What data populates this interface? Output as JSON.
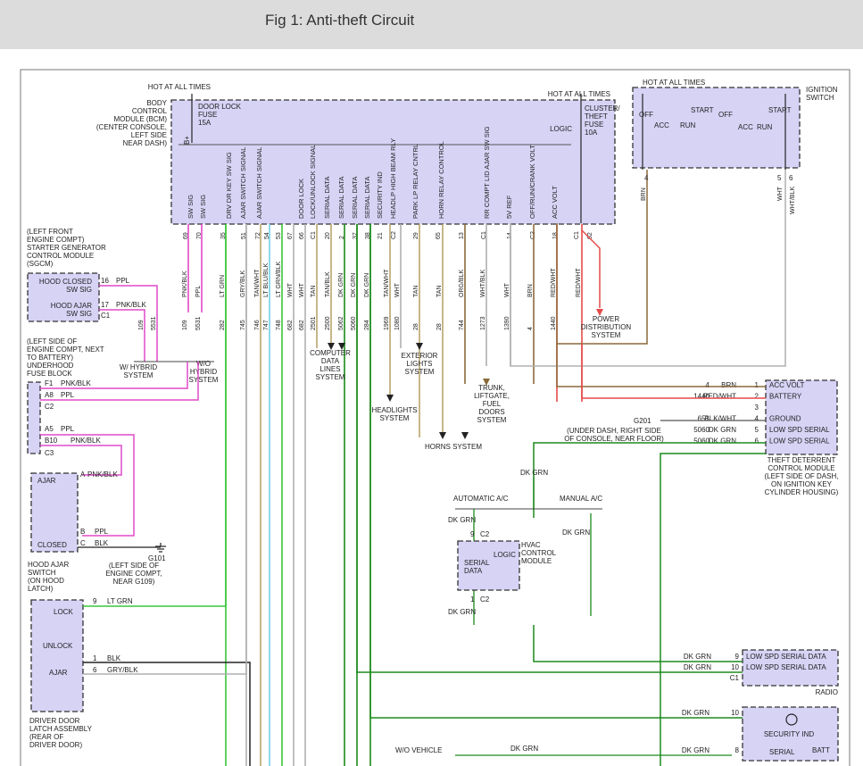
{
  "page_title": "Fig 1: Anti-theft Circuit",
  "colors": {
    "module_fill": "#d6d3f5",
    "green": "#38c638",
    "dark_green": "#1b8a1b",
    "pink": "#e04ac8",
    "brown": "#8a6a3a",
    "red": "#e64a4a",
    "gray": "#b0b0b0",
    "tan": "#b9a46d",
    "light_blue": "#6fd0e6"
  },
  "bcm": {
    "hot_at_all_times": "HOT AT ALL TIMES",
    "label_lines": [
      "BODY",
      "CONTROL",
      "MODULE (BCM)",
      "(CENTER CONSOLE,",
      "LEFT SIDE",
      "NEAR DASH)"
    ],
    "door_lock_fuse": [
      "DOOR LOCK",
      "FUSE",
      "15A"
    ],
    "b_plus": "B+",
    "hot_at_all_times_2": "HOT AT ALL TIMES",
    "cluster_fuse": [
      "CLUSTER/",
      "THEFT",
      "FUSE",
      "10A"
    ],
    "logic": "LOGIC",
    "signals": [
      "SW SIG",
      "SW SIG",
      "DRV DR KEY SW SIG",
      "AJAR SWITCH SIGNAL",
      "AJAR SWITCH SIGNAL",
      "DOOR LOCK",
      "LOCK/UNLOCK SIGNAL",
      "SERIAL DATA",
      "SERIAL DATA",
      "SERIAL DATA",
      "SERIAL DATA",
      "SECURITY IND",
      "HEADLP HIGH BEAM RLY",
      "PARK LP RELAY CNTRL",
      "HORN RELAY CONTROL",
      "RR COMPT LID AJAR SW SIG",
      "5V REF",
      "OFF/RUN/CRANK VOLT",
      "ACC VOLT"
    ],
    "pins": [
      "69",
      "70",
      "35",
      "51",
      "72",
      "54",
      "53",
      "67",
      "66",
      "C1",
      "20",
      "2",
      "37",
      "38",
      "21",
      "C2",
      "29",
      "65",
      "13",
      "C1",
      "14",
      "C2",
      "18",
      "C1",
      "62",
      "56",
      "C2",
      "C8",
      "F1",
      "C4"
    ],
    "wire_colors": [
      "PNK/BLK",
      "PPL",
      "LT GRN",
      "GRY/BLK",
      "TAN/WHT",
      "LT BLU/BLK",
      "LT GRN/BLK",
      "WHT",
      "WHT",
      "TAN",
      "TAN/BLK",
      "DK GRN",
      "DK GRN",
      "DK GRN",
      "TAN/WHT",
      "WHT",
      "TAN",
      "TAN",
      "ORG/BLK",
      "WHT/BLK",
      "WHT",
      "BRN",
      "RED/WHT",
      "RED/WHT"
    ],
    "circuits": [
      "109",
      "5531",
      "282",
      "745",
      "746",
      "747",
      "748",
      "682",
      "682",
      "2501",
      "2500",
      "5062",
      "5060",
      "284",
      "1969",
      "1080",
      "28",
      "28",
      "744",
      "1273",
      "1390",
      "4",
      "1440"
    ]
  },
  "ignition": {
    "hot": "HOT AT ALL TIMES",
    "label": [
      "IGNITION",
      "SWITCH"
    ],
    "off": "OFF",
    "start": "START",
    "acc": "ACC",
    "run": "RUN",
    "pins": [
      "4",
      "5",
      "6"
    ],
    "wire_colors": [
      "BRN",
      "WHT",
      "WHT/BLK"
    ]
  },
  "sgcm": {
    "label_lines": [
      "(LEFT FRONT",
      "ENGINE COMPT)",
      "STARTER GENERATOR",
      "CONTROL MODULE",
      "(SGCM)"
    ],
    "hood_closed": [
      "HOOD CLOSED",
      "SW SIG"
    ],
    "hood_ajar": [
      "HOOD AJAR",
      "SW SIG"
    ],
    "pins": [
      "16",
      "17",
      "C1"
    ],
    "wires": [
      "PPL",
      "PNK/BLK"
    ],
    "circuits": [
      "109",
      "5531"
    ],
    "with_hybrid": [
      "W/ HYBRID",
      "SYSTEM"
    ],
    "without_hybrid": [
      "W/O",
      "HYBRID",
      "SYSTEM"
    ]
  },
  "fuse_block": {
    "label_lines": [
      "(LEFT SIDE OF",
      "ENGINE COMPT, NEXT",
      "TO BATTERY)",
      "UNDERHOOD",
      "FUSE BLOCK"
    ],
    "pins": [
      "F1",
      "A8",
      "C2",
      "A5",
      "B10",
      "C3"
    ],
    "wires": [
      "PNK/BLK",
      "PPL",
      "PPL",
      "PNK/BLK"
    ]
  },
  "hood_switch": {
    "ajar": "AJAR",
    "closed": "CLOSED",
    "pins": [
      "A",
      "B",
      "C"
    ],
    "wires": [
      "PNK/BLK",
      "PPL",
      "BLK"
    ],
    "label_lines": [
      "HOOD AJAR",
      "SWITCH",
      "(ON HOOD",
      "LATCH)"
    ],
    "ground": "G101",
    "ground_location": [
      "(LEFT SIDE OF",
      "ENGINE COMPT,",
      "NEAR G109)"
    ]
  },
  "driver_latch": {
    "lock": "LOCK",
    "unlock": "UNLOCK",
    "ajar": "AJAR",
    "pins": [
      "9",
      "1",
      "6"
    ],
    "wires": [
      "LT GRN",
      "BLK",
      "GRY/BLK"
    ],
    "label_lines": [
      "DRIVER DOOR",
      "LATCH ASSEMBLY",
      "(REAR OF",
      "DRIVER DOOR)"
    ]
  },
  "destinations": {
    "computer_data": [
      "COMPUTER",
      "DATA",
      "LINES",
      "SYSTEM"
    ],
    "exterior_lights": [
      "EXTERIOR",
      "LIGHTS",
      "SYSTEM"
    ],
    "headlights": [
      "HEADLIGHTS",
      "SYSTEM"
    ],
    "horns": "HORNS SYSTEM",
    "trunk": [
      "TRUNK,",
      "LIFTGATE,",
      "FUEL",
      "DOORS",
      "SYSTEM"
    ],
    "power_dist": [
      "POWER",
      "DISTRIBUTION",
      "SYSTEM"
    ]
  },
  "theft_module": {
    "rows": [
      {
        "circuit": "4",
        "wire": "BRN",
        "pin": "1",
        "label": "ACC VOLT"
      },
      {
        "circuit": "1440",
        "wire": "RED/WHT",
        "pin": "2",
        "label": "BATTERY"
      },
      {
        "circuit": "",
        "wire": "",
        "pin": "3",
        "label": ""
      },
      {
        "circuit": "651",
        "wire": "BLK/WHT",
        "pin": "4",
        "label": "GROUND"
      },
      {
        "circuit": "5060",
        "wire": "DK GRN",
        "pin": "5",
        "label": "LOW SPD SERIAL"
      },
      {
        "circuit": "5060",
        "wire": "DK GRN",
        "pin": "6",
        "label": "LOW SPD SERIAL"
      }
    ],
    "ground": "G201",
    "under_dash": [
      "(UNDER DASH, RIGHT SIDE",
      "OF CONSOLE, NEAR FLOOR)"
    ],
    "label_lines": [
      "THEFT DETERRENT",
      "CONTROL MODULE",
      "(LEFT SIDE OF DASH,",
      "ON IGNITION KEY",
      "CYLINDER HOUSING)"
    ]
  },
  "hvac": {
    "dk_grn": "DK GRN",
    "automatic": "AUTOMATIC A/C",
    "manual": "MANUAL A/C",
    "pins": [
      "9",
      "C2",
      "1",
      "C2"
    ],
    "serial_data": [
      "SERIAL",
      "DATA"
    ],
    "logic": "LOGIC",
    "label_lines": [
      "HVAC",
      "CONTROL",
      "MODULE"
    ]
  },
  "radio": {
    "rows": [
      {
        "wire": "DK GRN",
        "pin": "9",
        "label": "LOW SPD SERIAL DATA"
      },
      {
        "wire": "DK GRN",
        "pin": "10",
        "label": "LOW SPD SERIAL DATA"
      },
      {
        "wire": "",
        "pin": "C1",
        "label": ""
      }
    ],
    "label": "RADIO"
  },
  "security": {
    "wire1": "DK GRN",
    "pin1": "10",
    "label": "SECURITY IND",
    "wire2": "DK GRN",
    "pin2": "8",
    "serial": "SERIAL",
    "batt": "BATT"
  },
  "wo_vehicle": "W/O VEHICLE",
  "bottom_wire": "DK GRN"
}
